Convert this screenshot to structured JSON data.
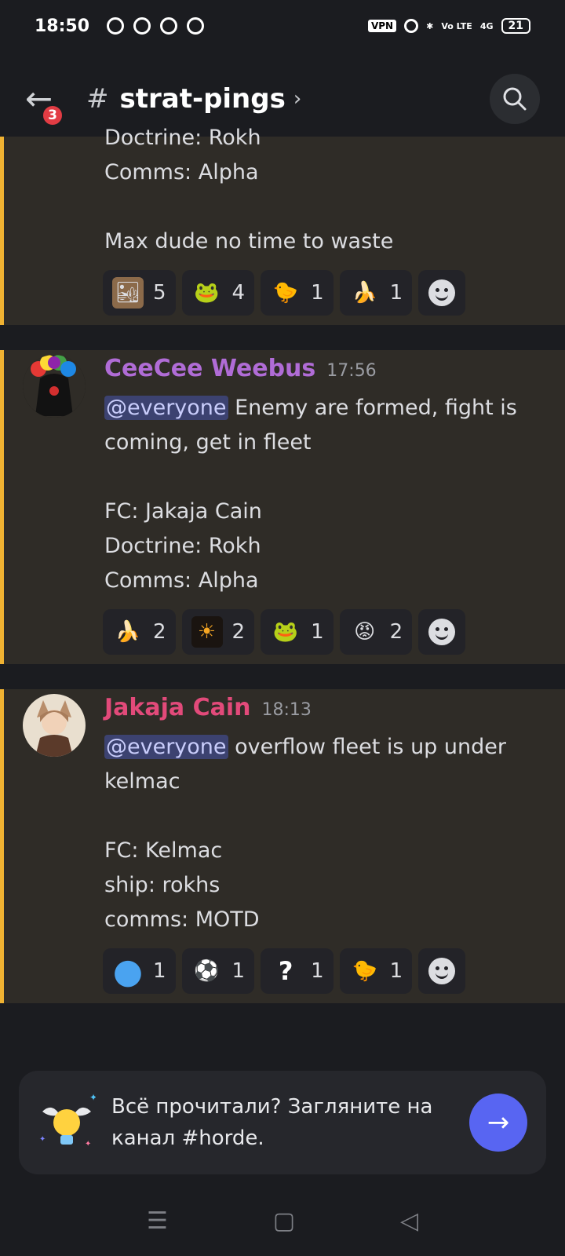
{
  "status": {
    "time": "18:50",
    "vpn": "VPN",
    "volte": "Vo LTE",
    "network": "4G",
    "battery": "21"
  },
  "header": {
    "back_badge": "3",
    "hash": "#",
    "channel_name": "strat-pings",
    "chevron": "›",
    "search_icon": "search-icon"
  },
  "messages": [
    {
      "lines": "Doctrine: Rokh\nComms: Alpha\n\nMax dude no time to waste",
      "reactions": [
        {
          "emoji": "🏜",
          "count": "5",
          "bg": "#8b6a4a"
        },
        {
          "emoji": "🐸",
          "count": "4",
          "bg": "transparent"
        },
        {
          "emoji": "🐤",
          "count": "1",
          "bg": "transparent"
        },
        {
          "emoji": "🍌",
          "count": "1",
          "bg": "transparent"
        }
      ]
    },
    {
      "author": "CeeCee Weebus",
      "author_color": "#b06cd6",
      "time": "17:56",
      "mention": "@everyone",
      "first_line": " Enemy are formed, fight is coming, get in fleet",
      "lines": "FC: Jakaja Cain\nDoctrine: Rokh\nComms: Alpha",
      "reactions": [
        {
          "emoji": "🍌",
          "count": "2",
          "bg": "transparent"
        },
        {
          "emoji": "☀",
          "count": "2",
          "bg": "#1a1410"
        },
        {
          "emoji": "🐸",
          "count": "1",
          "bg": "transparent"
        },
        {
          "emoji": "😡",
          "count": "2",
          "bg": "transparent"
        }
      ]
    },
    {
      "author": "Jakaja Cain",
      "author_color": "#e24a7a",
      "time": "18:13",
      "mention": "@everyone",
      "first_line": " overflow fleet is up under kelmac",
      "lines": "FC: Kelmac\nship: rokhs\ncomms: MOTD",
      "reactions": [
        {
          "emoji": "●",
          "count": "1",
          "bg": "transparent"
        },
        {
          "emoji": "⚽",
          "count": "1",
          "bg": "transparent"
        },
        {
          "emoji": "?",
          "count": "1",
          "bg": "transparent"
        },
        {
          "emoji": "🐤",
          "count": "1",
          "bg": "transparent"
        }
      ]
    }
  ],
  "banner": {
    "text": "Всё прочитали? Загляните на канал #horde.",
    "go_arrow": "→"
  },
  "nav": {
    "menu": "☰",
    "home": "▢",
    "back": "◁"
  }
}
